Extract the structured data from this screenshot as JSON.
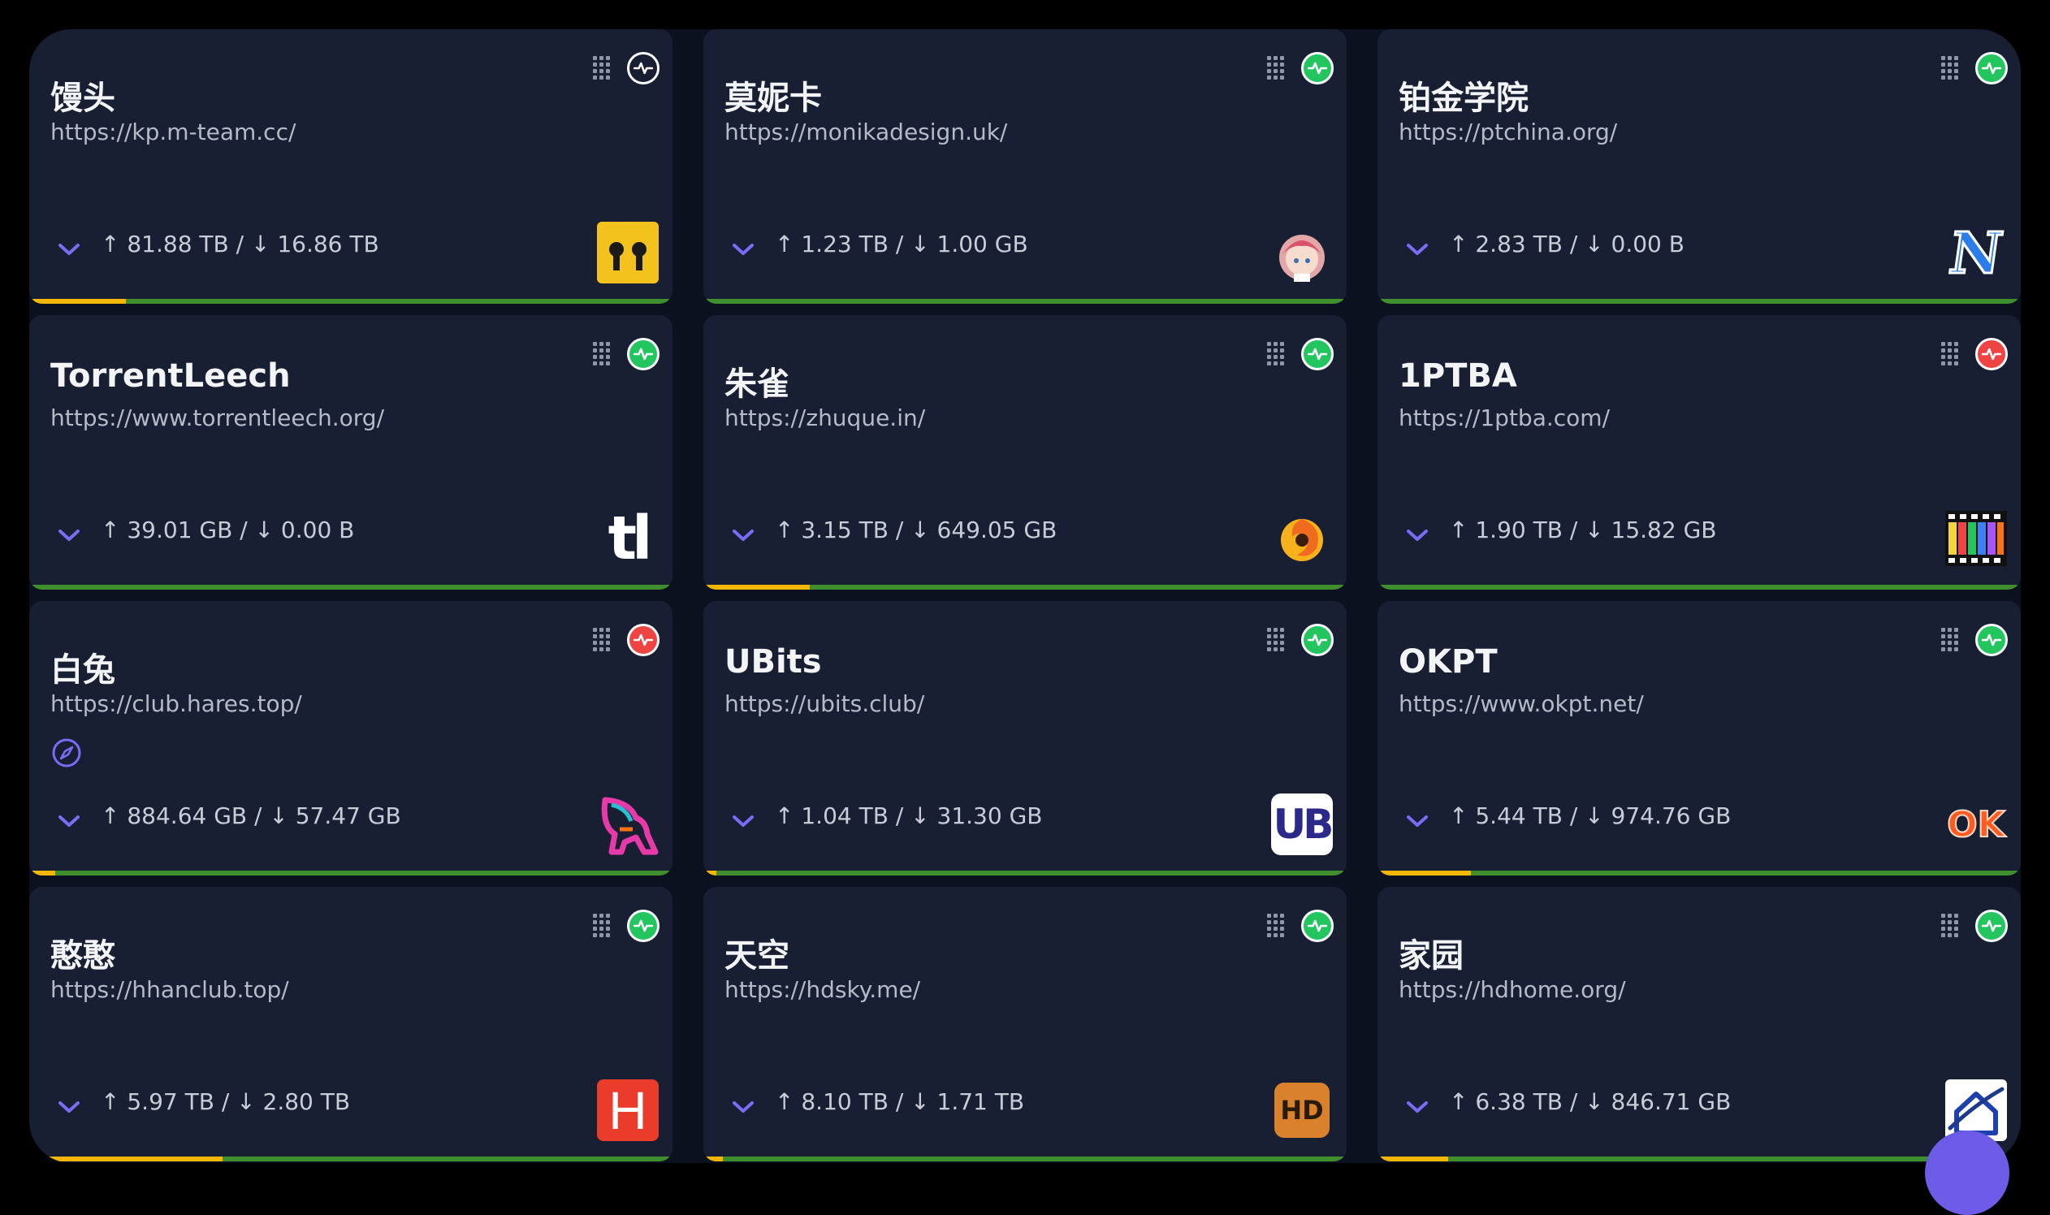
{
  "sites": [
    {
      "name": "馒头",
      "url": "https://kp.m-team.cc/",
      "traffic": "↑ 81.88 TB / ↓ 16.86 TB",
      "status": "online",
      "logo": "mteam-logo",
      "progress": 0.15
    },
    {
      "name": "莫妮卡",
      "url": "https://monikadesign.uk/",
      "traffic": "↑ 1.23 TB / ↓ 1.00 GB",
      "status": "online",
      "logo": "monika-avatar-logo",
      "progress": 0
    },
    {
      "name": "铂金学院",
      "url": "https://ptchina.org/",
      "traffic": "↑ 2.83 TB / ↓ 0.00 B",
      "status": "online",
      "logo": "ptchina-n-logo",
      "progress": 0
    },
    {
      "name": "TorrentLeech",
      "url": "https://www.torrentleech.org/",
      "traffic": "↑ 39.01 GB / ↓ 0.00 B",
      "status": "online",
      "logo": "torrentleech-tl-logo",
      "progress": 0
    },
    {
      "name": "朱雀",
      "url": "https://zhuque.in/",
      "traffic": "↑ 3.15 TB / ↓ 649.05 GB",
      "status": "online",
      "logo": "zhuque-flame-logo",
      "progress": 0.165
    },
    {
      "name": "1PTBA",
      "url": "https://1ptba.com/",
      "traffic": "↑ 1.90 TB / ↓ 15.82 GB",
      "status": "offline",
      "logo": "1ptba-filmstrip-logo",
      "progress": 0
    },
    {
      "name": "白兔",
      "url": "https://club.hares.top/",
      "traffic": "↑ 884.64 GB / ↓ 57.47 GB",
      "status": "offline",
      "logo": "hares-rabbit-logo",
      "progress": 0.04,
      "extra_icon": "compass-icon"
    },
    {
      "name": "UBits",
      "url": "https://ubits.club/",
      "traffic": "↑ 1.04 TB / ↓ 31.30 GB",
      "status": "online",
      "logo": "ubits-ub-logo",
      "progress": 0.02
    },
    {
      "name": "OKPT",
      "url": "https://www.okpt.net/",
      "traffic": "↑ 5.44 TB / ↓ 974.76 GB",
      "status": "online",
      "logo": "okpt-ok-logo",
      "progress": 0.145
    },
    {
      "name": "憨憨",
      "url": "https://hhanclub.top/",
      "traffic": "↑ 5.97 TB / ↓ 2.80 TB",
      "status": "online",
      "logo": "hhanclub-h-logo",
      "progress": 0.3
    },
    {
      "name": "天空",
      "url": "https://hdsky.me/",
      "traffic": "↑ 8.10 TB / ↓ 1.71 TB",
      "status": "online",
      "logo": "hdsky-hd-logo",
      "progress": 0.03
    },
    {
      "name": "家园",
      "url": "https://hdhome.org/",
      "traffic": "↑ 6.38 TB / ↓ 846.71 GB",
      "status": "online",
      "logo": "hdhome-house-logo",
      "progress": 0.11
    }
  ],
  "logo_text": {
    "ubits": "UB",
    "okpt": "OK",
    "hhanclub": "H",
    "hdsky": "HD",
    "ptchina": "N",
    "torrentleech": "tl"
  },
  "colors": {
    "online": "#22c55e",
    "offline": "#ef4444",
    "progress_track": "#3f8f2e",
    "progress_fill": "#f5b60a",
    "accent": "#7b6cf6",
    "card": "#181f33"
  }
}
